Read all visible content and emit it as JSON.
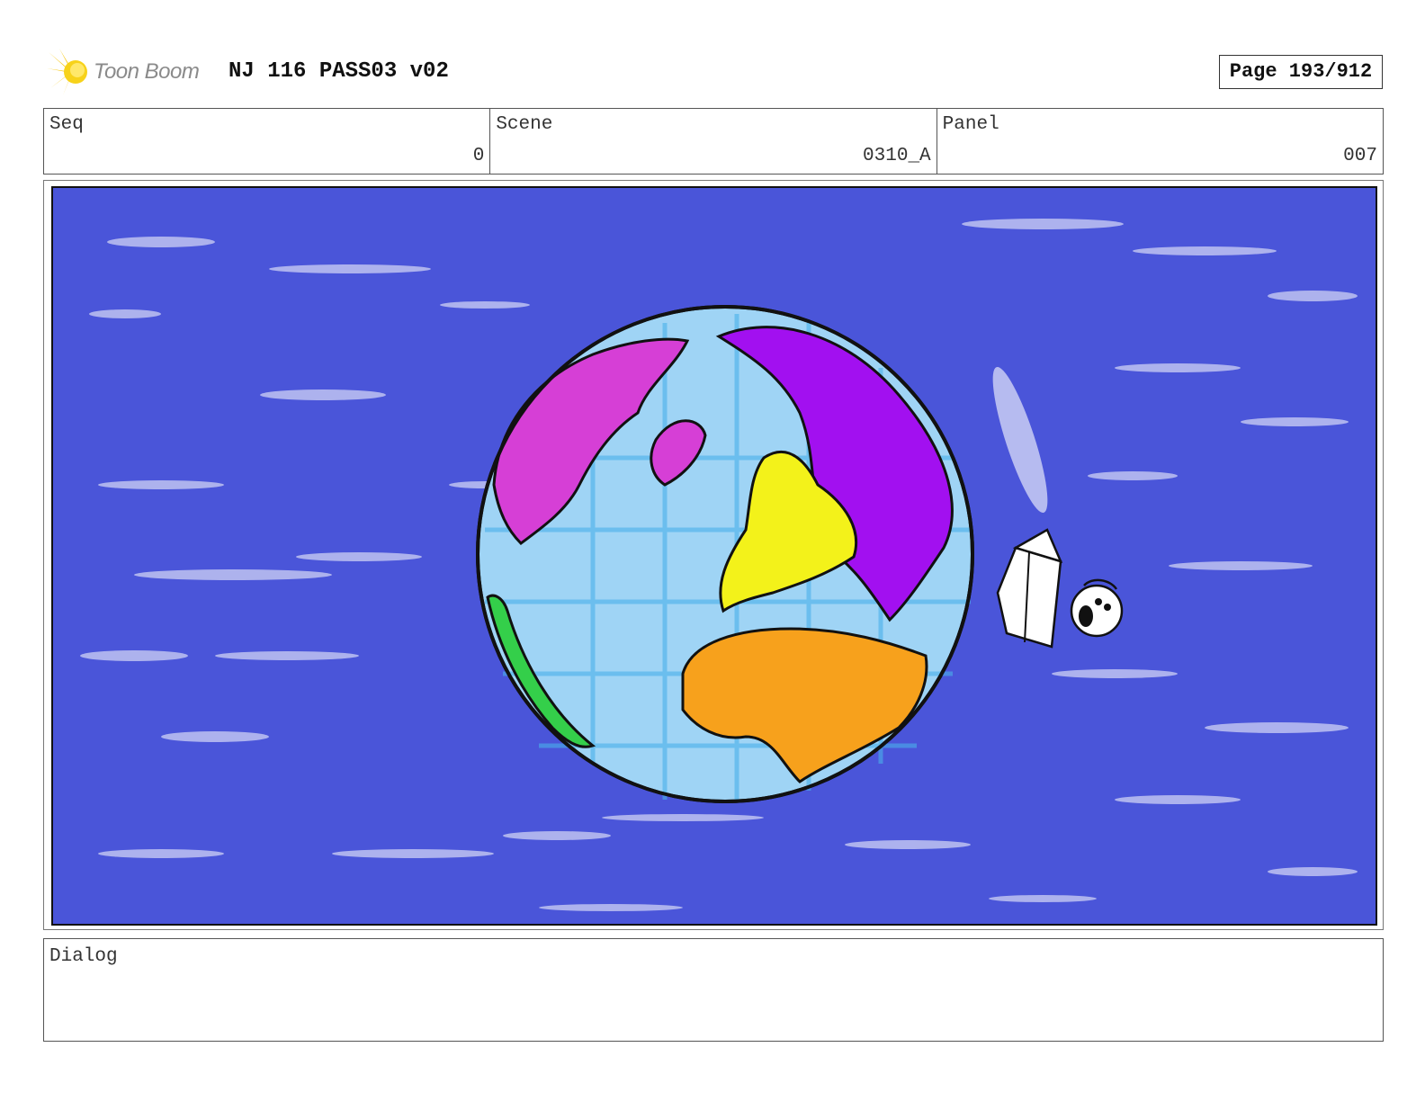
{
  "header": {
    "logo_text": "Toon Boom",
    "title": "NJ 116 PASS03 v02",
    "page": "Page 193/912"
  },
  "info": {
    "seq_label": "Seq",
    "seq_value": "0",
    "scene_label": "Scene",
    "scene_value": "0310_A",
    "panel_label": "Panel",
    "panel_value": "007"
  },
  "dialog": {
    "label": "Dialog",
    "text": ""
  },
  "colors": {
    "sky": "#4a55d9",
    "ocean": "#9fd4f5",
    "north_america": "#d63fd6",
    "asia": "#a210f0",
    "europe": "#f3f21a",
    "africa": "#f7a11c",
    "south_america": "#34cf4a"
  }
}
